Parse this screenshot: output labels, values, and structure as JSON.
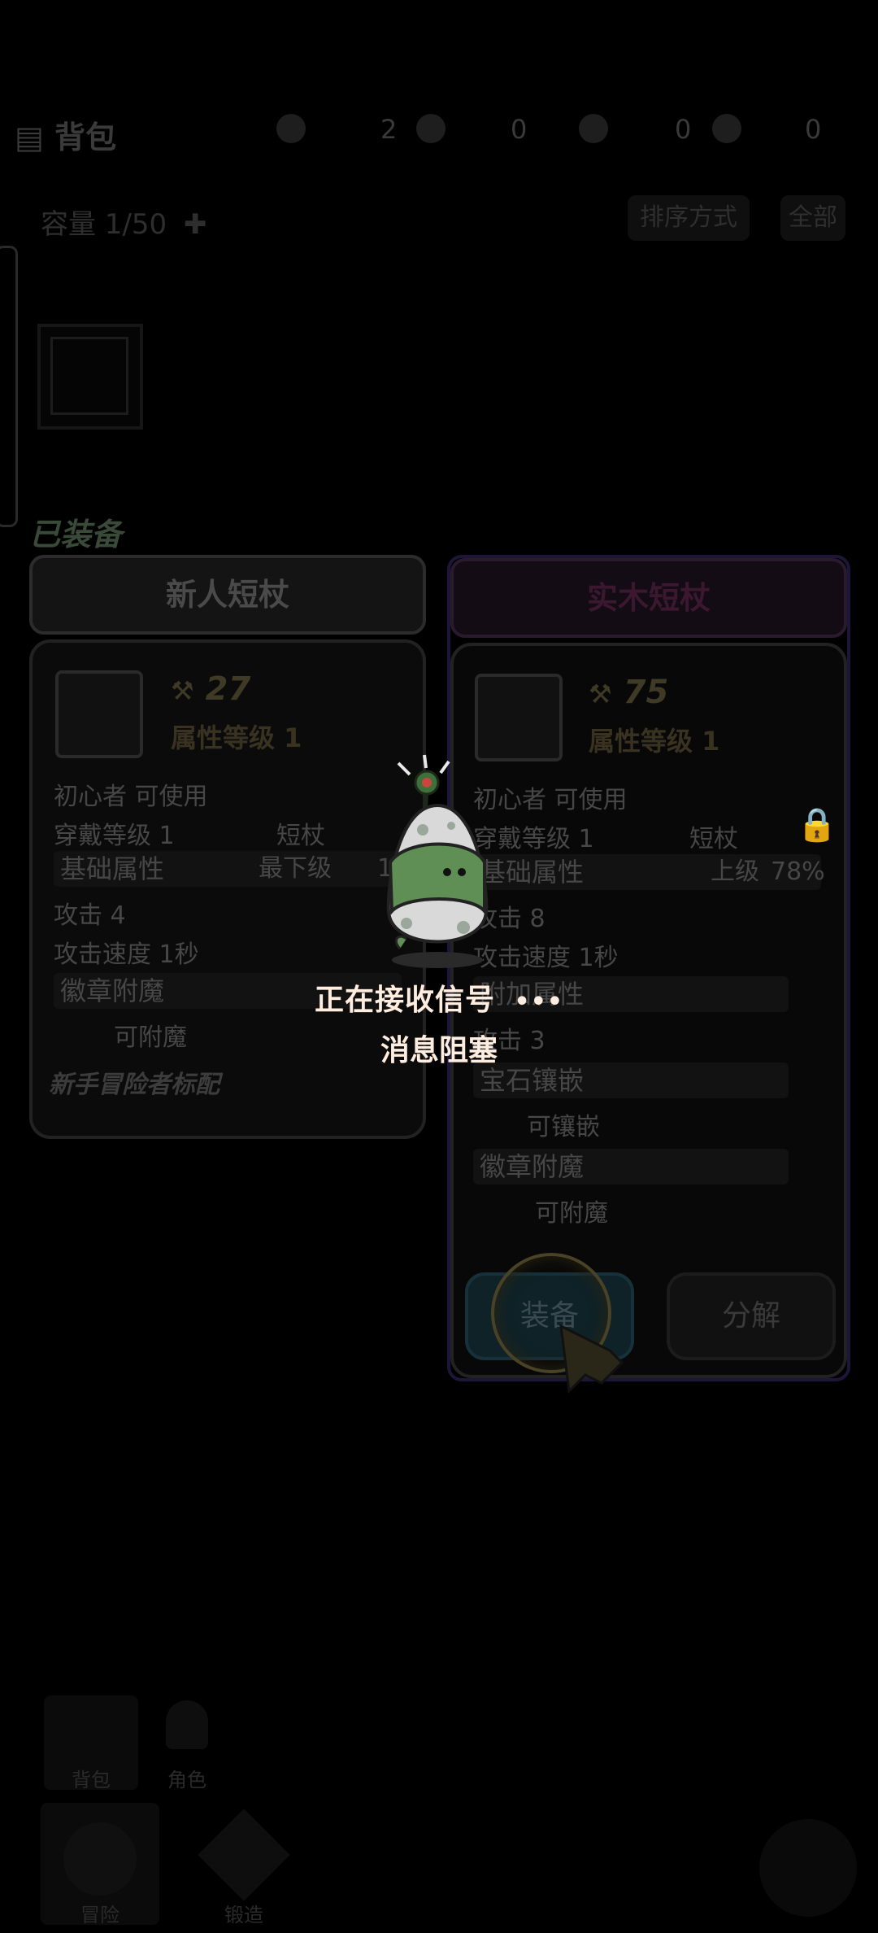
{
  "top_bar": {
    "title": "背包",
    "resources": [
      {
        "icon": "gem-icon",
        "value": "2"
      },
      {
        "icon": "feather-icon",
        "value": "0"
      },
      {
        "icon": "hourglass-icon",
        "value": "0"
      },
      {
        "icon": "shield-icon",
        "value": "0"
      }
    ]
  },
  "inventory": {
    "capacity": "容量 1/50",
    "sort_label": "排序方式",
    "more_label": "全部"
  },
  "equipped_tag": "已装备",
  "left_card": {
    "name": "新人短杖",
    "power": "27",
    "attr_level": "属性等级 1",
    "usable": "初心者 可使用",
    "wear_level": "穿戴等级 1",
    "type": "短杖",
    "base_attr_title": "基础属性",
    "grade": "最下级",
    "grade_pct": "13%",
    "attack": "攻击  4",
    "attack_speed": "攻击速度  1秒",
    "badge_title": "徽章附魔",
    "badge_value": "可附魔",
    "flavor": "新手冒险者标配"
  },
  "right_card": {
    "name": "实木短杖",
    "power": "75",
    "attr_level": "属性等级 1",
    "usable": "初心者 可使用",
    "wear_level": "穿戴等级 1",
    "type": "短杖",
    "base_attr_title": "基础属性",
    "grade": "上级",
    "grade_pct": "78%",
    "attack": "攻击  8",
    "attack_speed": "攻击速度  1秒",
    "extra_title": "附加属性",
    "extra_value": "攻击  3",
    "gem_title": "宝石镶嵌",
    "gem_value": "可镶嵌",
    "badge_title": "徽章附魔",
    "badge_value": "可附魔",
    "equip_label": "装备",
    "decompose_label": "分解"
  },
  "loading": {
    "line1": "正在接收信号",
    "dots": "•••",
    "line2": "消息阻塞"
  },
  "bottom_nav": {
    "items": [
      {
        "label": "背包"
      },
      {
        "label": "角色"
      },
      {
        "label": "冒险"
      },
      {
        "label": "锻造"
      }
    ]
  },
  "colors": {
    "overlay_text": "#ffeee0",
    "right_card_border": "#1d1638",
    "equip_button": "#0f2228"
  }
}
